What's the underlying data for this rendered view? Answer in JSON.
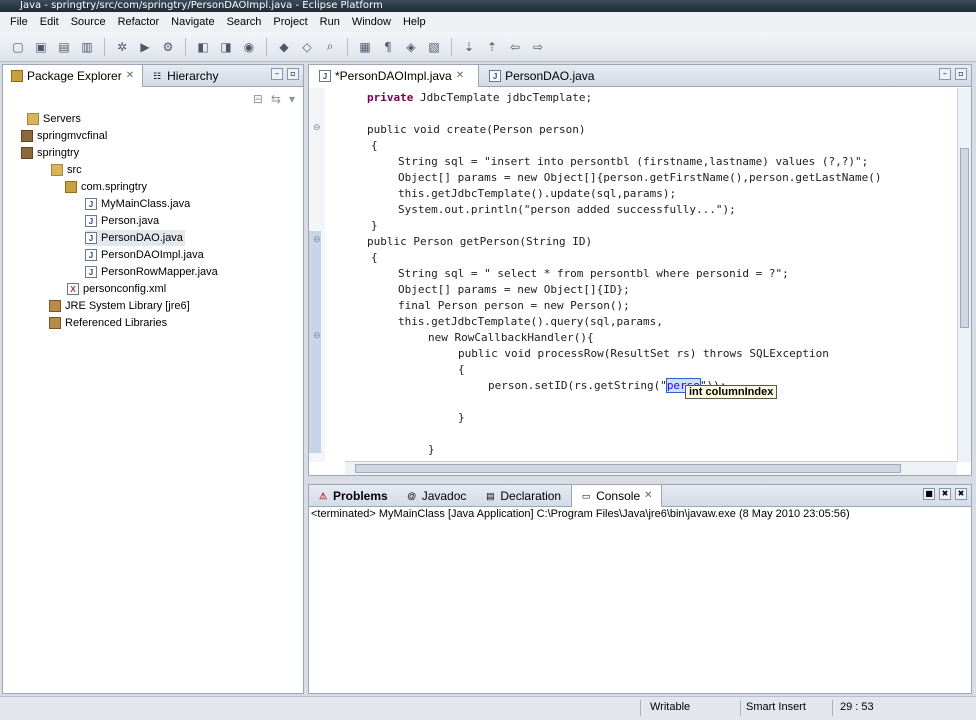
{
  "window": {
    "title": "Java - springtry/src/com/springtry/PersonDAOImpl.java - Eclipse Platform"
  },
  "menu": [
    "File",
    "Edit",
    "Source",
    "Refactor",
    "Navigate",
    "Search",
    "Project",
    "Run",
    "Window",
    "Help"
  ],
  "package_explorer": {
    "tabs": [
      {
        "label": "Package Explorer",
        "icon": "package-explorer-icon"
      },
      {
        "label": "Hierarchy",
        "icon": "hierarchy-icon"
      }
    ],
    "tree": [
      {
        "label": "Servers",
        "icon": "folder-icon"
      },
      {
        "label": "springmvcfinal",
        "icon": "project-icon"
      },
      {
        "label": "springtry",
        "icon": "project-icon"
      },
      {
        "label": "src",
        "icon": "source-folder-icon"
      },
      {
        "label": "com.springtry",
        "icon": "package-icon"
      },
      {
        "label": "MyMainClass.java",
        "icon": "java-file-icon"
      },
      {
        "label": "Person.java",
        "icon": "java-file-icon"
      },
      {
        "label": "PersonDAO.java",
        "icon": "java-file-icon",
        "selected": true
      },
      {
        "label": "PersonDAOImpl.java",
        "icon": "java-file-icon"
      },
      {
        "label": "PersonRowMapper.java",
        "icon": "java-file-icon"
      },
      {
        "label": "personconfig.xml",
        "icon": "xml-file-icon"
      },
      {
        "label": "JRE System Library [jre6]",
        "icon": "library-icon"
      },
      {
        "label": "Referenced Libraries",
        "icon": "library-icon"
      }
    ]
  },
  "editor": {
    "tabs": [
      {
        "label": "*PersonDAOImpl.java",
        "active": true
      },
      {
        "label": "PersonDAO.java",
        "active": false
      }
    ],
    "code": [
      "private JdbcTemplate jdbcTemplate;",
      "public void create(Person person)",
      "{",
      "String sql = \"insert into persontbl (firstname,lastname) values (?,?)\";",
      "Object[] params = new Object[]{person.getFirstName(),person.getLastName()",
      "this.getJdbcTemplate().update(sql,params);",
      "System.out.println(\"person added successfully...\");",
      "}",
      "public Person getPerson(String ID)",
      "{",
      "String sql = \" select * from persontbl where personid = ?\";",
      "Object[] params = new Object[]{ID};",
      "final Person person = new Person();",
      "this.getJdbcTemplate().query(sql,params,",
      "new RowCallbackHandler(){",
      "public void processRow(ResultSet rs) throws SQLException",
      "{",
      "person.setID(rs.getString(\"",
      "perso",
      "\"));",
      "}",
      "}"
    ],
    "content_assist_hint": "int columnIndex"
  },
  "bottom_panel": {
    "tabs": [
      {
        "label": "Problems",
        "icon": "problems-icon"
      },
      {
        "label": "Javadoc",
        "icon": "javadoc-icon"
      },
      {
        "label": "Declaration",
        "icon": "declaration-icon"
      },
      {
        "label": "Console",
        "icon": "console-icon",
        "active": true
      }
    ],
    "console_status": "<terminated> MyMainClass [Java Application] C:\\Program Files\\Java\\jre6\\bin\\javaw.exe (8 May 2010 23:05:56)"
  },
  "statusbar": {
    "writable": "Writable",
    "insert_mode": "Smart Insert",
    "position": "29 : 53"
  }
}
